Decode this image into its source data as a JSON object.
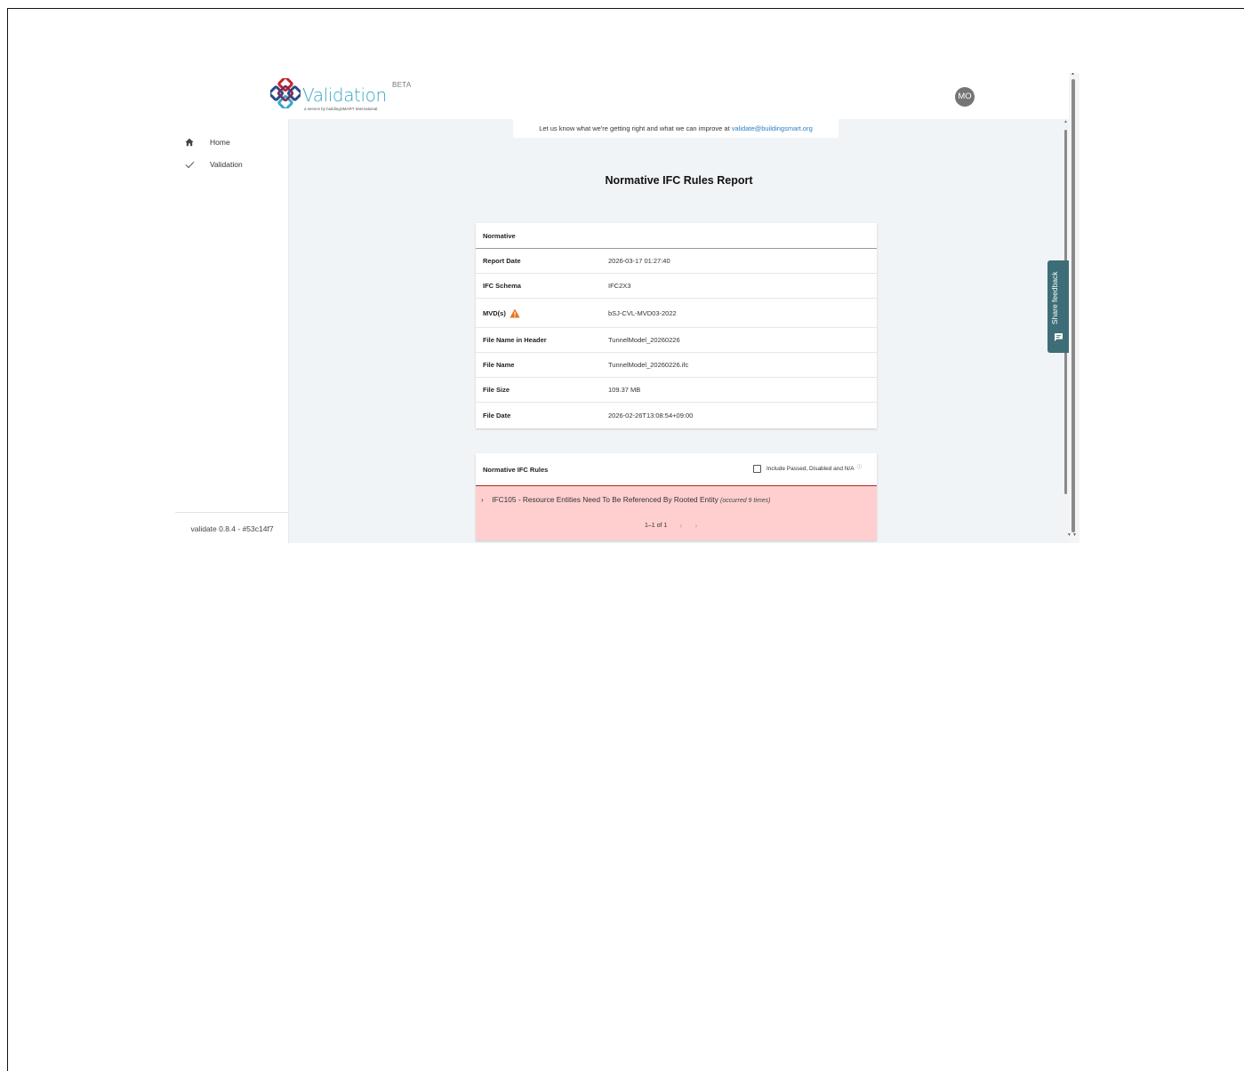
{
  "header": {
    "logo_text": "Validation",
    "logo_tagline": "a service by buildingSMART International",
    "beta_label": "BETA",
    "avatar_initials": "MO"
  },
  "sidebar": {
    "items": [
      {
        "label": "Home",
        "icon": "home-icon"
      },
      {
        "label": "Validation",
        "icon": "check-icon"
      }
    ],
    "version": "validate 0.8.4 - #53c14f7"
  },
  "banner": {
    "text": "Let us know what we're getting right and what we can improve at ",
    "email": "validate@buildingsmart.org"
  },
  "report": {
    "title": "Normative IFC Rules Report",
    "info_card": {
      "heading": "Normative",
      "rows": [
        {
          "key": "Report Date",
          "value": "2026-03-17 01:27:40"
        },
        {
          "key": "IFC Schema",
          "value": "IFC2X3"
        },
        {
          "key": "MVD(s)",
          "value": "bSJ-CVL-MVD03-2022",
          "warning": true
        },
        {
          "key": "File Name in Header",
          "value": "TunnelModel_20260226"
        },
        {
          "key": "File Name",
          "value": "TunnelModel_20260226.ifc"
        },
        {
          "key": "File Size",
          "value": "109.37 MB"
        },
        {
          "key": "File Date",
          "value": "2026-02-26T13:08:54+09:00"
        }
      ]
    },
    "rules_card": {
      "heading": "Normative IFC Rules",
      "checkbox_label": "Include Passed, Disabled and N/A",
      "checkbox_checked": false,
      "info_icon": "ⓘ",
      "rule": {
        "chevron": "›",
        "text": "IFC105 - Resource Entities Need To Be Referenced By Rooted Entity",
        "occurrence": "(occurred 9 times)"
      },
      "pager": {
        "text": "1–1 of 1",
        "prev": "‹",
        "next": "›"
      }
    }
  },
  "feedback": {
    "label": "Share feedback"
  },
  "colors": {
    "accent": "#3aa7c6",
    "link": "#2b7fc3",
    "error_bg": "#ffcfcf",
    "error_border": "#b3261e",
    "warning": "#e8731c",
    "feedback_bg": "#3d6e78",
    "main_bg": "#f1f4f7"
  }
}
